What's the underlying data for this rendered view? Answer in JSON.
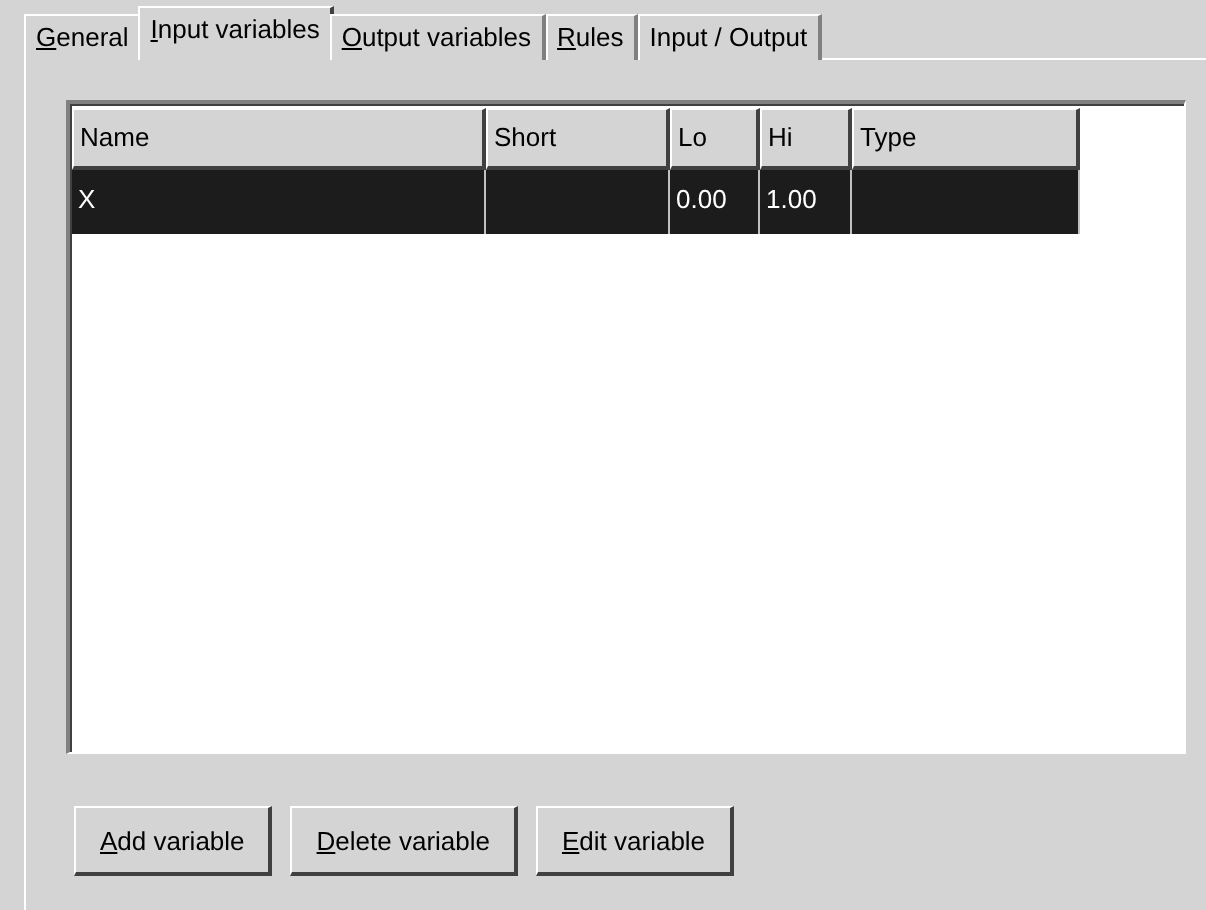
{
  "tabs": [
    {
      "label": "General",
      "selected": false,
      "mnemonic": true
    },
    {
      "label": "Input variables",
      "selected": true,
      "mnemonic": true
    },
    {
      "label": "Output variables",
      "selected": false,
      "mnemonic": true
    },
    {
      "label": "Rules",
      "selected": false,
      "mnemonic": true
    },
    {
      "label": "Input / Output",
      "selected": false,
      "mnemonic": false
    }
  ],
  "table": {
    "columns": [
      "Name",
      "Short",
      "Lo",
      "Hi",
      "Type"
    ],
    "rows": [
      {
        "cells": [
          "X",
          "",
          "0.00",
          "1.00",
          ""
        ],
        "selected": true
      }
    ]
  },
  "buttons": [
    {
      "label": "Add variable",
      "mnemonic": true
    },
    {
      "label": "Delete variable",
      "mnemonic": true
    },
    {
      "label": "Edit variable",
      "mnemonic": true
    }
  ]
}
